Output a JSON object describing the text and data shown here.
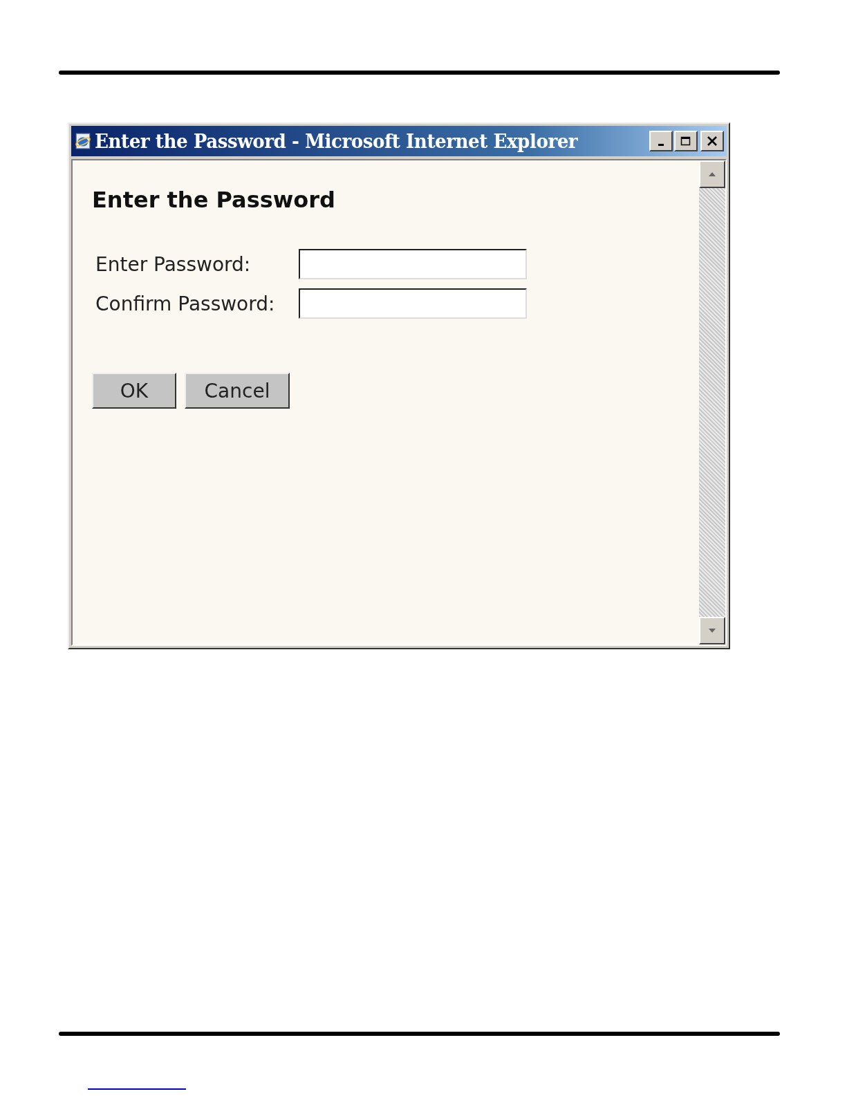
{
  "window": {
    "title": "Enter the Password - Microsoft Internet Explorer"
  },
  "heading": "Enter the Password",
  "fields": [
    {
      "label": "Enter Password:"
    },
    {
      "label": "Confirm Password:"
    }
  ],
  "buttons": [
    "OK",
    "Cancel"
  ]
}
